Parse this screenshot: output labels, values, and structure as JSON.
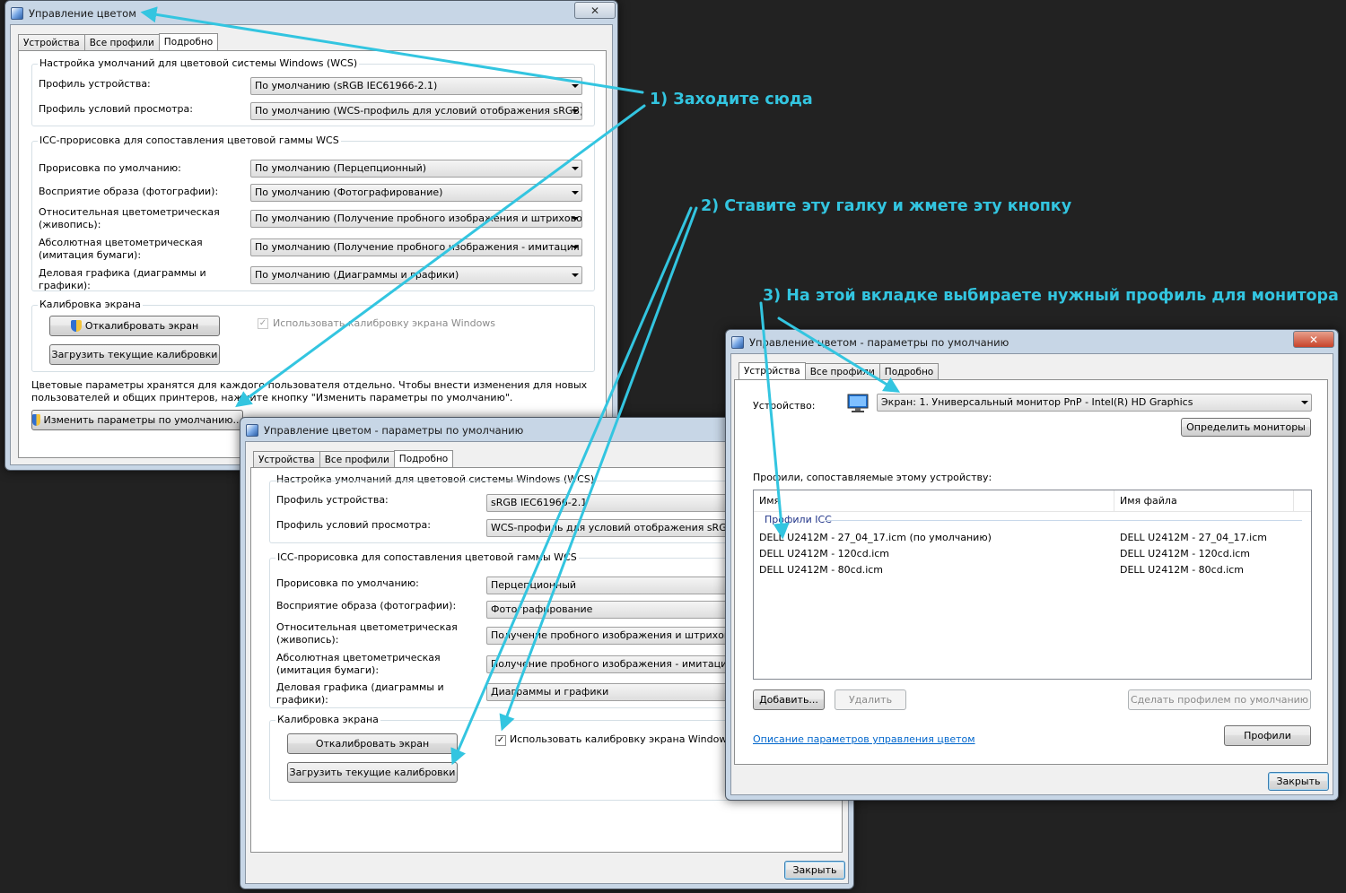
{
  "w1": {
    "title": "Управление цветом",
    "close": "✕",
    "tabs": [
      "Устройства",
      "Все профили",
      "Подробно"
    ],
    "wcs_group": "Настройка умолчаний для цветовой системы Windows (WCS)",
    "device_profile_label": "Профиль устройства:",
    "device_profile_value": "По умолчанию (sRGB IEC61966-2.1)",
    "viewing_label": "Профиль условий просмотра:",
    "viewing_value": "По умолчанию (WCS-профиль для условий отображения sRGB)",
    "icc_group": "ICC-прорисовка для сопоставления цветовой гаммы WCS",
    "rows": [
      {
        "label": "Прорисовка по умолчанию:",
        "value": "По умолчанию (Перцепционный)"
      },
      {
        "label": "Восприятие образа (фотографии):",
        "value": "По умолчанию (Фотографирование)"
      },
      {
        "label": "Относительная цветометрическая\n(живопись):",
        "value": "По умолчанию (Получение пробного изображения и штриховой р"
      },
      {
        "label": "Абсолютная цветометрическая\n(имитация бумаги):",
        "value": "По умолчанию (Получение пробного изображения - имитация цве"
      },
      {
        "label": "Деловая графика (диаграммы и\nграфики):",
        "value": "По умолчанию (Диаграммы и графики)"
      }
    ],
    "calib_group": "Калибровка экрана",
    "calibrate_btn": "Откалибровать экран",
    "load_btn": "Загрузить текущие калибровки",
    "use_calib": "Использовать калибровку экрана Windows",
    "info": "Цветовые параметры хранятся для каждого пользователя отдельно. Чтобы внести изменения для новых пользователей и общих принтеров, нажмите кнопку \"Изменить параметры по умолчанию\".",
    "change_btn": "Изменить параметры по умолчанию..."
  },
  "w2": {
    "title": "Управление цветом - параметры по умолчанию",
    "tabs": [
      "Устройства",
      "Все профили",
      "Подробно"
    ],
    "wcs_group": "Настройка умолчаний для цветовой системы Windows (WCS)",
    "device_profile_label": "Профиль устройства:",
    "device_profile_value": "sRGB IEC61966-2.1",
    "viewing_label": "Профиль условий просмотра:",
    "viewing_value": "WCS-профиль для условий отображения sRGB",
    "icc_group": "ICC-прорисовка для сопоставления цветовой гаммы WCS",
    "rows": [
      {
        "label": "Прорисовка по умолчанию:",
        "value": "Перцепционный"
      },
      {
        "label": "Восприятие образа (фотографии):",
        "value": "Фотографирование"
      },
      {
        "label": "Относительная цветометрическая\n(живопись):",
        "value": "Получение пробного изображения и штриховой р"
      },
      {
        "label": "Абсолютная цветометрическая\n(имитация бумаги):",
        "value": "Получение пробного изображения - имитация цве"
      },
      {
        "label": "Деловая графика (диаграммы и\nграфики):",
        "value": "Диаграммы и графики"
      }
    ],
    "calib_group": "Калибровка экрана",
    "calibrate_btn": "Откалибровать экран",
    "load_btn": "Загрузить текущие калибровки",
    "use_calib": "Использовать калибровку экрана Windows",
    "close_btn": "Закрыть"
  },
  "w3": {
    "title": "Управление цветом - параметры по умолчанию",
    "close": "✕",
    "tabs": [
      "Устройства",
      "Все профили",
      "Подробно"
    ],
    "device_label": "Устройство:",
    "device_value": "Экран: 1. Универсальный монитор PnP - Intel(R) HD Graphics",
    "identify_btn": "Определить мониторы",
    "profiles_label": "Профили, сопоставляемые этому устройству:",
    "col_name": "Имя",
    "col_file": "Имя файла",
    "group_name": "Профили ICC",
    "profiles": [
      {
        "name": "DELL U2412M - 27_04_17.icm (по умолчанию)",
        "file": "DELL U2412M - 27_04_17.icm"
      },
      {
        "name": "DELL U2412M - 120cd.icm",
        "file": "DELL U2412M - 120cd.icm"
      },
      {
        "name": "DELL U2412M - 80cd.icm",
        "file": "DELL U2412M - 80cd.icm"
      }
    ],
    "add_btn": "Добавить...",
    "remove_btn": "Удалить",
    "set_default_btn": "Сделать профилем по умолчанию",
    "link": "Описание параметров управления цветом",
    "profiles_btn": "Профили",
    "close_btn": "Закрыть"
  },
  "annotations": {
    "a1": "1) Заходите сюда",
    "a2": "2) Ставите эту галку и жмете эту кнопку",
    "a3": "3) На этой вкладке выбираете нужный профиль для монитора"
  },
  "colors": {
    "annotation": "#33c5e0",
    "background": "#222222"
  }
}
